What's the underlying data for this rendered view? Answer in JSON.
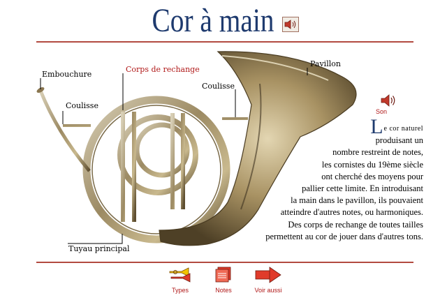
{
  "title": "Cor à main",
  "labels": {
    "embouchure": "Embouchure",
    "corps_rechange": "Corps de rechange",
    "pavillon": "Pavillon",
    "coulisse_left": "Coulisse",
    "coulisse_right": "Coulisse",
    "tuyau": "Tuyau principal"
  },
  "sound": {
    "label": "Son"
  },
  "description": {
    "dropcap": "L",
    "lead": "e cor naturel",
    "lines": [
      "produisant un",
      "nombre restreint de notes,",
      "les cornistes du 19ème siècle",
      "ont cherché des moyens pour",
      "pallier cette limite. En introduisant",
      "la main dans le pavillon, ils pouvaient",
      "atteindre d'autres notes, ou harmoniques.",
      "Des corps de rechange de toutes tailles",
      "permettent au cor de jouer dans d'autres tons."
    ]
  },
  "nav": [
    {
      "label": "Types",
      "icon": "trumpets-icon"
    },
    {
      "label": "Notes",
      "icon": "notes-icon"
    },
    {
      "label": "Voir aussi",
      "icon": "arrow-right-icon"
    }
  ],
  "colors": {
    "title": "#1e3a6e",
    "rule": "#b24a40",
    "accent": "#b01818",
    "brass": "#a89870"
  }
}
